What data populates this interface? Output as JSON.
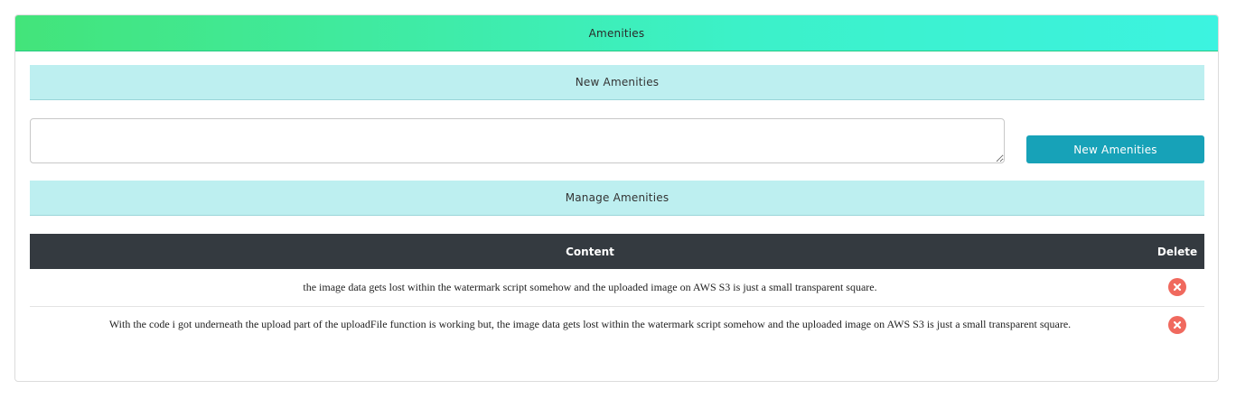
{
  "header": {
    "title": "Amenities"
  },
  "new_section": {
    "title": "New Amenities",
    "textarea_value": "",
    "button_label": "New Amenities"
  },
  "manage_section": {
    "title": "Manage Amenities"
  },
  "table": {
    "columns": [
      "Content",
      "Delete"
    ],
    "rows": [
      {
        "content": "the image data gets lost within the watermark script somehow and the uploaded image on AWS S3 is just a small transparent square.",
        "delete_icon": "times-circle-icon"
      },
      {
        "content": "With the code i got underneath the upload part of the uploadFile function is working but, the image data gets lost within the watermark script somehow and the uploaded image on AWS S3 is just a small transparent square.",
        "delete_icon": "times-circle-icon"
      }
    ]
  },
  "colors": {
    "header_gradient_start": "#43e47a",
    "header_gradient_end": "#3cf3e0",
    "section_bar": "#bdeff0",
    "button": "#17a2b8",
    "table_header": "#343a40",
    "delete_icon": "#f0695e"
  }
}
